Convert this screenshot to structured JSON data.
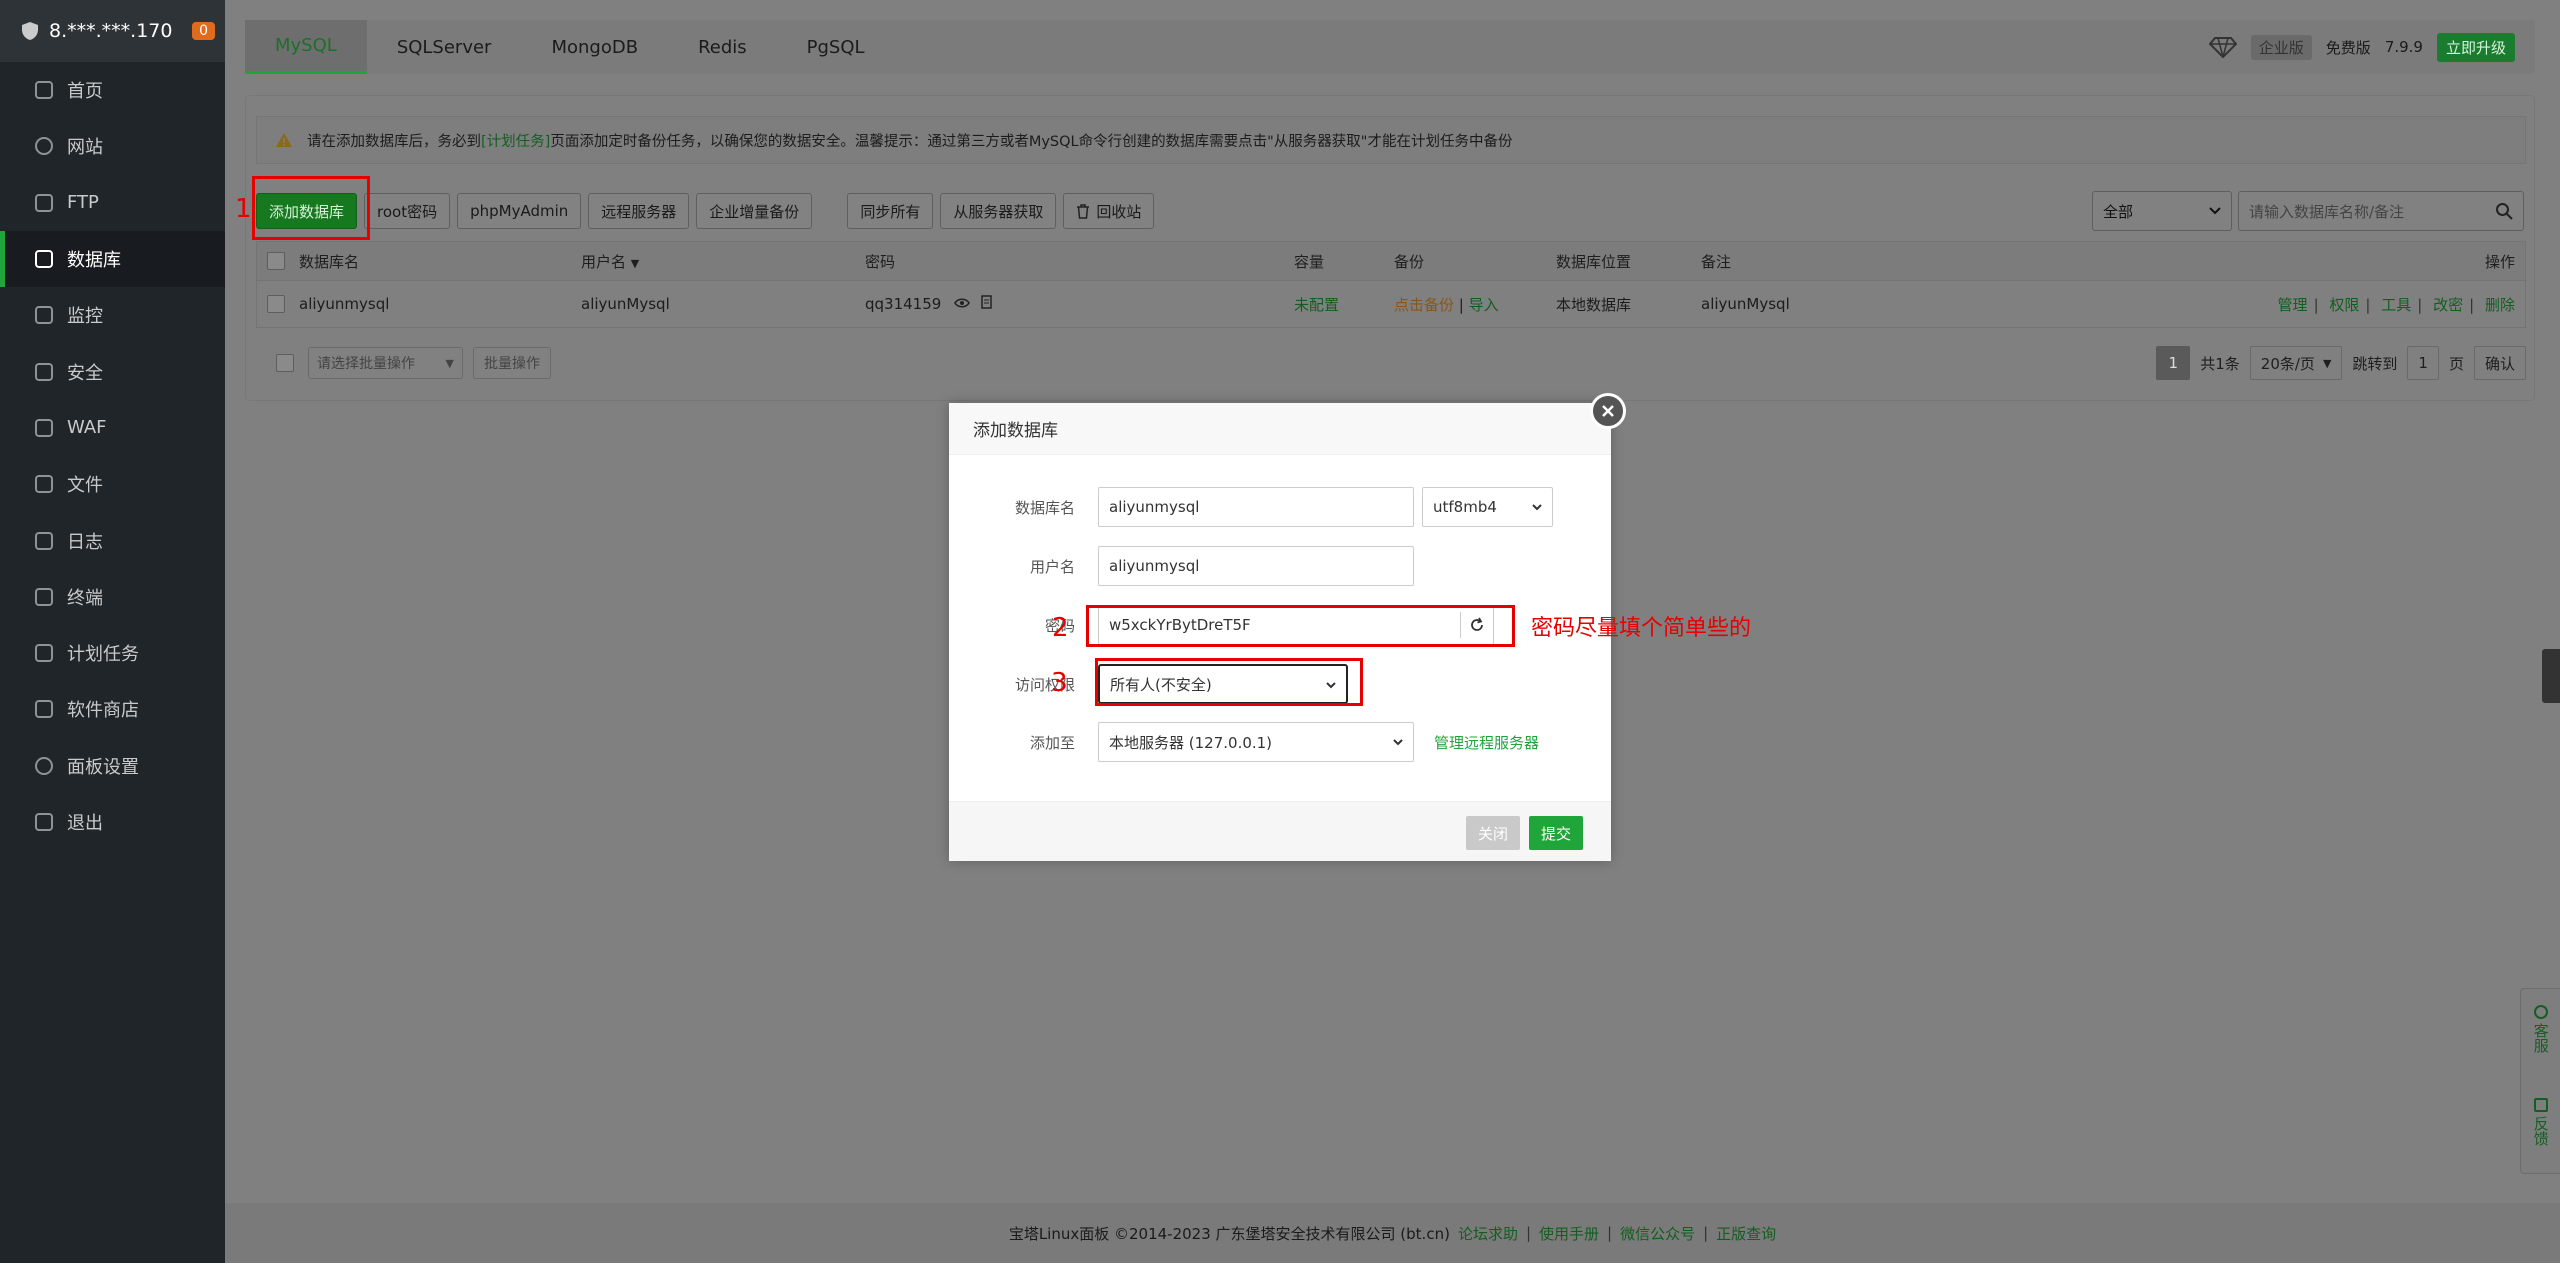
{
  "server": {
    "ip": "8.***.***.170",
    "badge": "0"
  },
  "sidebar": {
    "items": [
      {
        "label": "首页",
        "icon": "home-icon"
      },
      {
        "label": "网站",
        "icon": "globe-icon"
      },
      {
        "label": "FTP",
        "icon": "ftp-icon"
      },
      {
        "label": "数据库",
        "icon": "database-icon",
        "active": true
      },
      {
        "label": "监控",
        "icon": "monitor-icon"
      },
      {
        "label": "安全",
        "icon": "shield-check-icon"
      },
      {
        "label": "WAF",
        "icon": "waf-shield-icon"
      },
      {
        "label": "文件",
        "icon": "folder-icon"
      },
      {
        "label": "日志",
        "icon": "log-icon"
      },
      {
        "label": "终端",
        "icon": "terminal-icon"
      },
      {
        "label": "计划任务",
        "icon": "calendar-icon"
      },
      {
        "label": "软件商店",
        "icon": "grid-icon"
      },
      {
        "label": "面板设置",
        "icon": "gear-icon"
      },
      {
        "label": "退出",
        "icon": "logout-icon"
      }
    ]
  },
  "tabs": [
    "MySQL",
    "SQLServer",
    "MongoDB",
    "Redis",
    "PgSQL"
  ],
  "topbar": {
    "edition": "企业版",
    "free": "免费版",
    "version": "7.9.9",
    "upgrade": "立即升级"
  },
  "notice": {
    "before": "请在添加数据库后，务必到",
    "link": "[计划任务]",
    "after": "页面添加定时备份任务，以确保您的数据安全。温馨提示：通过第三方或者MySQL命令行创建的数据库需要点击\"从服务器获取\"才能在计划任务中备份"
  },
  "toolbar": {
    "add": "添加数据库",
    "root_pwd": "root密码",
    "phpmyadmin": "phpMyAdmin",
    "remote": "远程服务器",
    "enterprise_backup": "企业增量备份",
    "sync_all": "同步所有",
    "fetch_server": "从服务器获取",
    "recycle": "回收站",
    "filter": "全部",
    "search_placeholder": "请输入数据库名称/备注"
  },
  "table": {
    "headers": [
      "数据库名",
      "用户名",
      "密码",
      "容量",
      "备份",
      "数据库位置",
      "备注",
      "操作"
    ],
    "rows": [
      {
        "name": "aliyunmysql",
        "user": "aliyunMysql",
        "password": "qq314159",
        "capacity": "未配置",
        "backup": "点击备份",
        "import": "导入",
        "location": "本地数据库",
        "note": "aliyunMysql",
        "ops": [
          "管理",
          "权限",
          "工具",
          "改密",
          "删除"
        ]
      }
    ]
  },
  "batch": {
    "select": "请选择批量操作",
    "button": "批量操作"
  },
  "pager": {
    "current": "1",
    "total": "共1条",
    "per_page": "20条/页",
    "jump": "跳转到",
    "page_no": "1",
    "page_unit": "页",
    "confirm": "确认"
  },
  "footer": {
    "copyright": "宝塔Linux面板 ©2014-2023 广东堡塔安全技术有限公司 (bt.cn)",
    "links": [
      "论坛求助",
      "使用手册",
      "微信公众号",
      "正版查询"
    ]
  },
  "float": {
    "service": "客服",
    "feedback": "反馈"
  },
  "modal": {
    "title": "添加数据库",
    "db_name_label": "数据库名",
    "db_name": "aliyunmysql",
    "charset": "utf8mb4",
    "user_label": "用户名",
    "user": "aliyunmysql",
    "pwd_label": "密码",
    "pwd": "w5xckYrBytDreT5F",
    "access_label": "访问权限",
    "access": "所有人(不安全)",
    "add_to_label": "添加至",
    "add_to": "本地服务器 (127.0.0.1)",
    "manage_remote": "管理远程服务器",
    "close": "关闭",
    "submit": "提交"
  },
  "annotations": {
    "n1": "1",
    "n2": "2",
    "n3": "3",
    "hint": "密码尽量填个简单些的"
  },
  "colors": {
    "brand": "#20a53a",
    "annotation": "#e60000"
  }
}
